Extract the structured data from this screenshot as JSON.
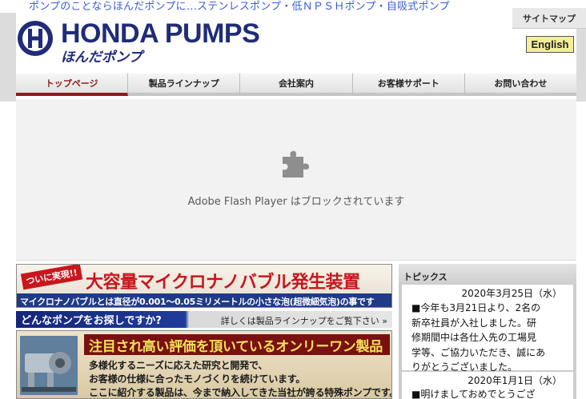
{
  "header": {
    "tagline": "ポンプのことならほんだポンプに…ステンレスポンプ・低ＮＰＳＨポンプ・自吸式ポンプ",
    "sitemap_label": "サイトマップ",
    "english_label": "English",
    "logo_text": "HONDA PUMPS",
    "logo_sub": "ほんだポンプ"
  },
  "nav": {
    "items": [
      "トップページ",
      "製品ラインナップ",
      "会社案内",
      "お客様サポート",
      "お問い合わせ"
    ],
    "active_index": 0
  },
  "flash": {
    "message": "Adobe Flash Player はブロックされています",
    "icon": "puzzle-piece-icon"
  },
  "banner1": {
    "tag": "ついに実現!!",
    "title": "大容量マイクロナノバブル発生装置",
    "subtitle": "マイクロナノバブルとは直径が0.001〜0.05ミリメートルの小さな泡(超微細気泡)の事です"
  },
  "search": {
    "title": "どんなポンプをお探しですか?",
    "link": "詳しくは製品ラインナップをご覧下さい"
  },
  "banner2": {
    "title": "注目され高い評価を頂いているオンリーワン製品",
    "lines": [
      "多様化するニーズに応えた研究と開発で、",
      "お客様の仕様に合ったモノづくりを続けています。",
      "ここに紹介する製品は、今まで納入してきた当社が誇る特殊ポンプです。"
    ]
  },
  "topics": {
    "heading": "トピックス",
    "entries": [
      {
        "date": "2020年3月25日（水）",
        "lines": [
          "■今年も3月21日より、2名の",
          "新卒社員が入社しました。研",
          "修期間中は各仕入先の工場見",
          "学等、ご協力いただき、誠にあ",
          "りがとうございました。"
        ]
      },
      {
        "date": "2020年1月1日（水）",
        "lines": [
          "■明けましておめでとうござ"
        ]
      }
    ]
  },
  "colors": {
    "brand_navy": "#1f2c7a",
    "accent_red": "#8b1a1a",
    "english_button": "#f3ee9a",
    "tagline_blue": "#3a5cd8"
  }
}
